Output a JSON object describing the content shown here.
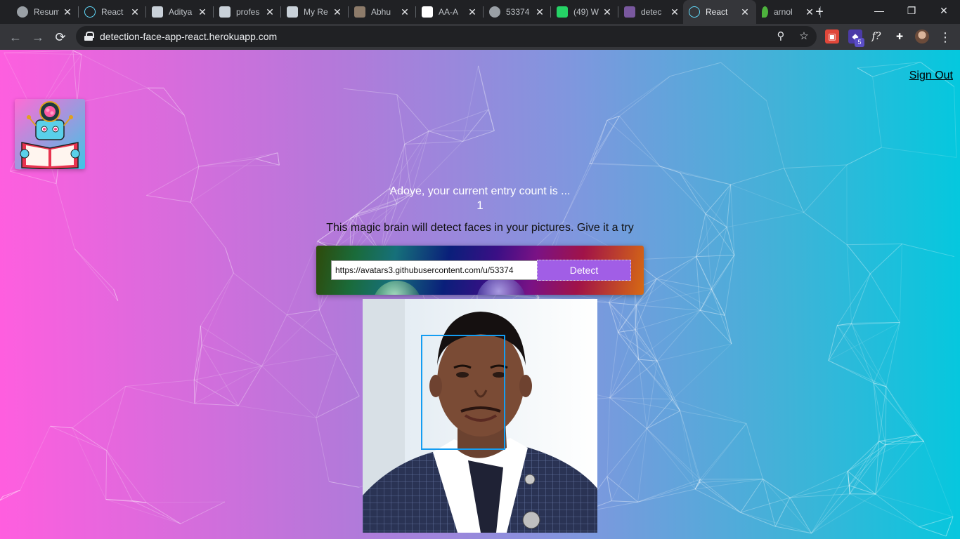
{
  "browser": {
    "tabs": [
      {
        "title": "Resum",
        "icon": "globe-icon",
        "color": "#9aa0a6",
        "active": false
      },
      {
        "title": "React",
        "icon": "react-icon",
        "color": "#61dafb",
        "active": false
      },
      {
        "title": "Aditya",
        "icon": "octocat-icon",
        "color": "#c9d1d9",
        "active": false
      },
      {
        "title": "profes",
        "icon": "octocat-icon",
        "color": "#c9d1d9",
        "active": false
      },
      {
        "title": "My Re",
        "icon": "octocat-icon",
        "color": "#c9d1d9",
        "active": false
      },
      {
        "title": "Abhu",
        "icon": "profile-icon",
        "color": "#8d7b6a",
        "active": false
      },
      {
        "title": "AA-A",
        "icon": "github-icon",
        "color": "#ffffff",
        "active": false
      },
      {
        "title": "53374",
        "icon": "globe-icon",
        "color": "#9aa0a6",
        "active": false
      },
      {
        "title": "(49) W",
        "icon": "whatsapp-icon",
        "color": "#25d366",
        "active": false
      },
      {
        "title": "detec",
        "icon": "heroku-icon",
        "color": "#79589f",
        "active": false
      },
      {
        "title": "React",
        "icon": "react-icon",
        "color": "#61dafb",
        "active": true
      },
      {
        "title": "arnol",
        "icon": "mongodb-leaf-icon",
        "color": "#4db33d",
        "active": false
      }
    ],
    "url": "detection-face-app-react.herokuapp.com",
    "extensions": [
      {
        "name": "red-extension-icon",
        "color": "#e0473a",
        "glyph": "▣"
      },
      {
        "name": "purple-extension-icon",
        "color": "#4b3ba7",
        "glyph": "◆"
      },
      {
        "name": "function-extension-icon",
        "color": "#35363a",
        "glyph": "f?"
      },
      {
        "name": "puzzle-extensions-icon",
        "color": "#35363a",
        "glyph": "✚"
      }
    ],
    "extension_badge": "5",
    "glyphs": {
      "close": "✕",
      "new_tab": "+",
      "minimize": "—",
      "restore": "❐",
      "window_close": "✕",
      "back": "←",
      "forward": "→",
      "reload": "⟳",
      "zoom": "⚲",
      "bookmark": "☆",
      "menu": "⋮"
    }
  },
  "page": {
    "sign_out": "Sign Out",
    "rank_message": "Adoye, your current entry count is ...",
    "rank_count": "1",
    "tagline": "This magic brain will detect faces in your pictures. Give it a try",
    "image_url_value": "https://avatars3.githubusercontent.com/u/53374",
    "detect_button": "Detect",
    "colors": {
      "gradient_start": "#ff5edf",
      "gradient_end": "#04c8de",
      "detect_button": "#a15ee6",
      "face_box": "#149df2"
    }
  }
}
